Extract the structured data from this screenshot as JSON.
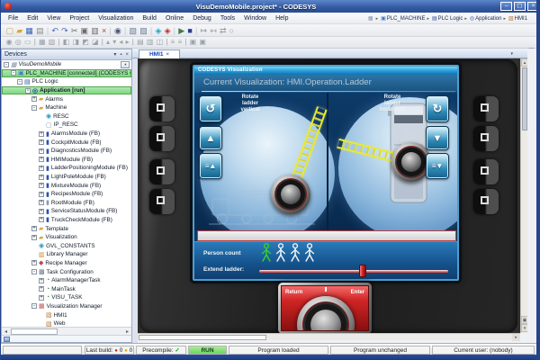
{
  "window": {
    "title": "VisuDemoMobile.project* - CODESYS",
    "minimize": "–",
    "maximize": "▢",
    "close": "×"
  },
  "menu": {
    "items": [
      "File",
      "Edit",
      "View",
      "Project",
      "Visualization",
      "Build",
      "Online",
      "Debug",
      "Tools",
      "Window",
      "Help"
    ]
  },
  "breadcrumb": {
    "items": [
      {
        "icon": "▦",
        "istyle": "color:#8898b0",
        "label": "",
        "sep": "▸"
      },
      {
        "icon": "▣",
        "istyle": "color:#3a80c8",
        "label": "PLC_MACHINE",
        "sep": "▸"
      },
      {
        "icon": "▤",
        "istyle": "color:#2a50a8",
        "label": "PLC Logic",
        "sep": "▸"
      },
      {
        "icon": "◎",
        "istyle": "color:#2a50a8",
        "label": "Application",
        "sep": "▸"
      },
      {
        "icon": "▧",
        "istyle": "color:#b87838",
        "label": "HMI1",
        "sep": ""
      }
    ]
  },
  "toolbar1": {
    "icons": [
      {
        "g": "▢",
        "istyle": "color:#caa84a"
      },
      {
        "g": "▰",
        "istyle": "color:#d8a73a"
      },
      {
        "g": "▦",
        "istyle": "color:#3a62b8"
      },
      {
        "g": "▤",
        "istyle": "color:#8a8a8a"
      },
      {
        "g": "|",
        "istyle": "color:#c6c6c6"
      },
      {
        "g": "↶",
        "istyle": "color:#4a6ab8"
      },
      {
        "g": "↷",
        "istyle": "color:#4a6ab8"
      },
      {
        "g": "✂",
        "istyle": "color:#6a6a6a"
      },
      {
        "g": "▣",
        "istyle": "color:#6a6a6a"
      },
      {
        "g": "▥",
        "istyle": "color:#6a6a6a"
      },
      {
        "g": "×",
        "istyle": "color:#b04040"
      },
      {
        "g": "|",
        "istyle": "color:#c6c6c6"
      },
      {
        "g": "◉",
        "istyle": "color:#4a5a78"
      },
      {
        "g": "|",
        "istyle": "color:#c6c6c6"
      },
      {
        "g": "▧",
        "istyle": "color:#6a7a92"
      },
      {
        "g": "▨",
        "istyle": "color:#6a7a92"
      },
      {
        "g": "|",
        "istyle": "color:#c6c6c6"
      },
      {
        "g": "◈",
        "istyle": "color:#2aa0c8"
      },
      {
        "g": "◈",
        "istyle": "color:#c03030"
      },
      {
        "g": "|",
        "istyle": "color:#c6c6c6"
      },
      {
        "g": "▶",
        "istyle": "color:#4a7a4a"
      },
      {
        "g": "■",
        "istyle": "color:#2a3c9c"
      },
      {
        "g": "|",
        "istyle": "color:#c6c6c6"
      },
      {
        "g": "↦",
        "istyle": "color:#9a9a9a"
      },
      {
        "g": "↤",
        "istyle": "color:#9a9a9a"
      },
      {
        "g": "⇄",
        "istyle": "color:#9a9a9a"
      },
      {
        "g": "○",
        "istyle": "color:#9a9a9a"
      }
    ]
  },
  "toolbar2": {
    "icons": [
      {
        "g": "◉"
      },
      {
        "g": "◎"
      },
      {
        "g": "▭"
      },
      {
        "g": "|"
      },
      {
        "g": "▦"
      },
      {
        "g": "▧"
      },
      {
        "g": "|"
      },
      {
        "g": "◧"
      },
      {
        "g": "◨"
      },
      {
        "g": "◩"
      },
      {
        "g": "◪"
      },
      {
        "g": "|"
      },
      {
        "g": "▴"
      },
      {
        "g": "▾"
      },
      {
        "g": "◂"
      },
      {
        "g": "▸"
      },
      {
        "g": "|"
      },
      {
        "g": "▤"
      },
      {
        "g": "▥"
      },
      {
        "g": "◫"
      },
      {
        "g": "|"
      },
      {
        "g": "≡"
      },
      {
        "g": "≡"
      },
      {
        "g": "|"
      },
      {
        "g": "▣"
      },
      {
        "g": "▣"
      }
    ]
  },
  "devices": {
    "title": "Devices",
    "collapse_icon": "▾",
    "pin_icon": "▪",
    "close_icon": "×",
    "scroll_left": "◂",
    "scroll_right": "▸",
    "items": [
      {
        "exp": "-",
        "icon": "▦",
        "istyle": "color:#8090a8",
        "label": "VisuDemoMobile",
        "style": "padding-left:2px;font-style:italic",
        "combo": "▾"
      },
      {
        "exp": "-",
        "icon": "▣",
        "istyle": "color:#3a80c8",
        "label": "PLC_MACHINE [connected] (CODESYS C",
        "style": "padding-left:9px;background:linear-gradient(180deg,#b0e8b0,#7ed87e);border:1px solid #50a850"
      },
      {
        "exp": "-",
        "icon": "▤",
        "istyle": "color:#2a50a8",
        "label": "PLC Logic",
        "style": "padding-left:17px"
      },
      {
        "exp": "-",
        "icon": "◎",
        "istyle": "color:#2a50a8",
        "label": "Application [run]",
        "style": "padding-left:25px;background:linear-gradient(180deg,#b0e8b0,#7ed87e);border:1px solid #50a850;font-weight:bold"
      },
      {
        "exp": "+",
        "icon": "▰",
        "istyle": "color:#d8a840",
        "label": "Alarms",
        "style": "padding-left:33px"
      },
      {
        "exp": "-",
        "icon": "▰",
        "istyle": "color:#d8a840",
        "label": "Machine",
        "style": "padding-left:33px"
      },
      {
        "exp": "",
        "icon": "◉",
        "istyle": "color:#28a0c8",
        "label": "RESC",
        "style": "padding-left:41px"
      },
      {
        "exp": "",
        "icon": "▢",
        "istyle": "color:#8898a8",
        "label": "IP_RESC",
        "style": "padding-left:41px"
      },
      {
        "exp": "+",
        "icon": "▮",
        "istyle": "color:#2a50b8",
        "label": "AlarmsModule (FB)",
        "style": "padding-left:41px"
      },
      {
        "exp": "+",
        "icon": "▮",
        "istyle": "color:#2a50b8",
        "label": "CockpitModule (FB)",
        "style": "padding-left:41px"
      },
      {
        "exp": "+",
        "icon": "▮",
        "istyle": "color:#2a50b8",
        "label": "DiagnosticsModule (FB)",
        "style": "padding-left:41px"
      },
      {
        "exp": "+",
        "icon": "▮",
        "istyle": "color:#2a50b8",
        "label": "HMIModule (FB)",
        "style": "padding-left:41px"
      },
      {
        "exp": "+",
        "icon": "▮",
        "istyle": "color:#2a50b8",
        "label": "LadderPositioningModule (FB)",
        "style": "padding-left:41px"
      },
      {
        "exp": "+",
        "icon": "▮",
        "istyle": "color:#2a50b8",
        "label": "LightPoleModule (FB)",
        "style": "padding-left:41px"
      },
      {
        "exp": "+",
        "icon": "▮",
        "istyle": "color:#2a50b8",
        "label": "MixtureModule (FB)",
        "style": "padding-left:41px"
      },
      {
        "exp": "+",
        "icon": "▮",
        "istyle": "color:#2a50b8",
        "label": "RecipesModule (FB)",
        "style": "padding-left:41px"
      },
      {
        "exp": "+",
        "icon": "▮",
        "istyle": "color:#8a9ab8",
        "label": "RootModule (FB)",
        "style": "padding-left:41px;color:#9aa0a8"
      },
      {
        "exp": "+",
        "icon": "▮",
        "istyle": "color:#2a50b8",
        "label": "ServiceStatusModule (FB)",
        "style": "padding-left:41px"
      },
      {
        "exp": "+",
        "icon": "▮",
        "istyle": "color:#2a50b8",
        "label": "TruckCheckModule (FB)",
        "style": "padding-left:41px"
      },
      {
        "exp": "+",
        "icon": "▰",
        "istyle": "color:#d8a840",
        "label": "Template",
        "style": "padding-left:33px"
      },
      {
        "exp": "+",
        "icon": "▰",
        "istyle": "color:#d8a840",
        "label": "Visualization",
        "style": "padding-left:33px"
      },
      {
        "exp": "",
        "icon": "◉",
        "istyle": "color:#28a0c8",
        "label": "GVL_CONSTANTS",
        "style": "padding-left:33px"
      },
      {
        "exp": "",
        "icon": "▥",
        "istyle": "color:#c08838",
        "label": "Library Manager",
        "style": "padding-left:33px"
      },
      {
        "exp": "+",
        "icon": "◆",
        "istyle": "color:#c04848",
        "label": "Recipe Manager",
        "style": "padding-left:33px"
      },
      {
        "exp": "-",
        "icon": "▩",
        "istyle": "color:#687888",
        "label": "Task Configuration",
        "style": "padding-left:33px"
      },
      {
        "exp": "+",
        "icon": "◔",
        "istyle": "color:#4a8858",
        "label": "AlarmManagerTask",
        "style": "padding-left:41px"
      },
      {
        "exp": "+",
        "icon": "◔",
        "istyle": "color:#4a8858",
        "label": "MainTask",
        "style": "padding-left:41px"
      },
      {
        "exp": "+",
        "icon": "◔",
        "istyle": "color:#4a8858",
        "label": "VISU_TASK",
        "style": "padding-left:41px"
      },
      {
        "exp": "-",
        "icon": "▦",
        "istyle": "color:#c05858",
        "label": "Visualization Manager",
        "style": "padding-left:33px"
      },
      {
        "exp": "",
        "icon": "▧",
        "istyle": "color:#b87838",
        "label": "HMI1",
        "style": "padding-left:41px"
      },
      {
        "exp": "",
        "icon": "▧",
        "istyle": "color:#b87838",
        "label": "Web",
        "style": "padding-left:41px"
      }
    ]
  },
  "editor": {
    "tab_label": "HMI1",
    "tab_close": "×",
    "tab_menu": "▾",
    "float_icon": "▣",
    "scroll_up": "▴",
    "scroll_down": "▾",
    "scroll_right": "▸",
    "scroll_thumb_icon": "▣"
  },
  "hmi": {
    "titlebar": "CODESYS Visualization",
    "heading": "Current Visualization: HMI.Operation.Ladder",
    "rotate_left_label": "Rotate\nladder\nvertical",
    "rotate_right_label": "Rotate\nladder\nhorizontal",
    "btn_rotate_ccw": "↺",
    "btn_up": "▲",
    "btn_ladder_up": "≡▲",
    "btn_rotate_cw": "↻",
    "btn_down": "▼",
    "btn_ladder_down": "≡▼",
    "person_label": "Person count",
    "extend_label": "Extend ladder:",
    "persons": [
      {
        "style": "color:#30d030"
      },
      {
        "style": "color:#eef2f4"
      },
      {
        "style": "color:#eef2f4"
      },
      {
        "style": "color:#eef2f4"
      }
    ],
    "return_label": "Return",
    "enter_label": "Enter"
  },
  "status": {
    "last_build_label": "Last build:",
    "err_icon": "●",
    "errors": "0",
    "warn_icon": "●",
    "warnings": "0",
    "precompile_label": "Precompile:",
    "precompile_ok": "✓",
    "run": "RUN",
    "loaded": "Program loaded",
    "unchanged": "Program unchanged",
    "user": "Current user: (nobody)"
  },
  "colors": {
    "run_green": "#84dc6c",
    "selection_green": "#8fe08f",
    "titlebar_blue": "#33599f",
    "hmi_cyan": "#29a0dc",
    "screen_navy": "#0d3a68",
    "alarm_border_red": "#b84040",
    "slider_red": "#d02020",
    "ladder_yellow": "#e8e838"
  }
}
